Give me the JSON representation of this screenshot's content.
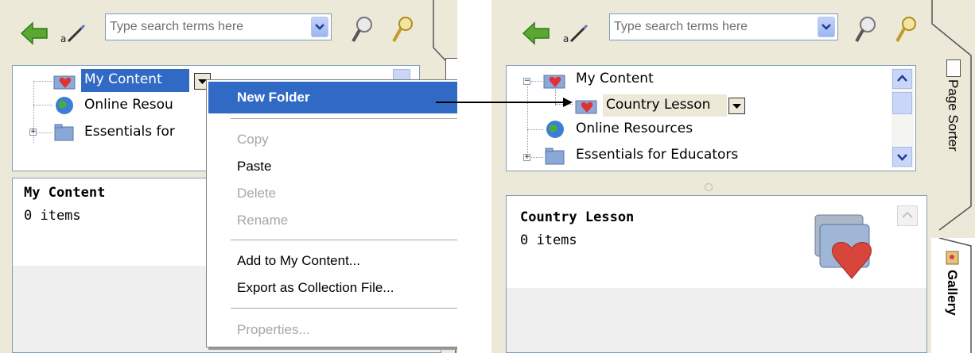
{
  "search": {
    "placeholder": "Type search terms here"
  },
  "left": {
    "tree": {
      "items": [
        {
          "label": "My Content"
        },
        {
          "label": "Online Resou"
        },
        {
          "label": "Essentials for"
        }
      ]
    },
    "info": {
      "title": "My Content",
      "count": "0 items"
    }
  },
  "context_menu": {
    "items": [
      {
        "label": "New Folder",
        "state": "highlighted"
      },
      {
        "label": "Copy",
        "state": "disabled"
      },
      {
        "label": "Paste",
        "state": "enabled"
      },
      {
        "label": "Delete",
        "state": "disabled"
      },
      {
        "label": "Rename",
        "state": "disabled"
      },
      {
        "label": "Add to My Content...",
        "state": "enabled"
      },
      {
        "label": "Export as Collection File...",
        "state": "enabled"
      },
      {
        "label": "Properties...",
        "state": "disabled"
      }
    ]
  },
  "right": {
    "tree": {
      "items": [
        {
          "label": "My Content"
        },
        {
          "label": "Country Lesson"
        },
        {
          "label": "Online Resources"
        },
        {
          "label": "Essentials for Educators"
        }
      ]
    },
    "info": {
      "title": "Country Lesson",
      "count": "0 items"
    },
    "tabs": {
      "page_sorter": "Page Sorter",
      "gallery": "Gallery"
    }
  },
  "colors": {
    "highlight": "#316ac5",
    "panel_bg": "#ece9d8",
    "border": "#7f9db9"
  }
}
